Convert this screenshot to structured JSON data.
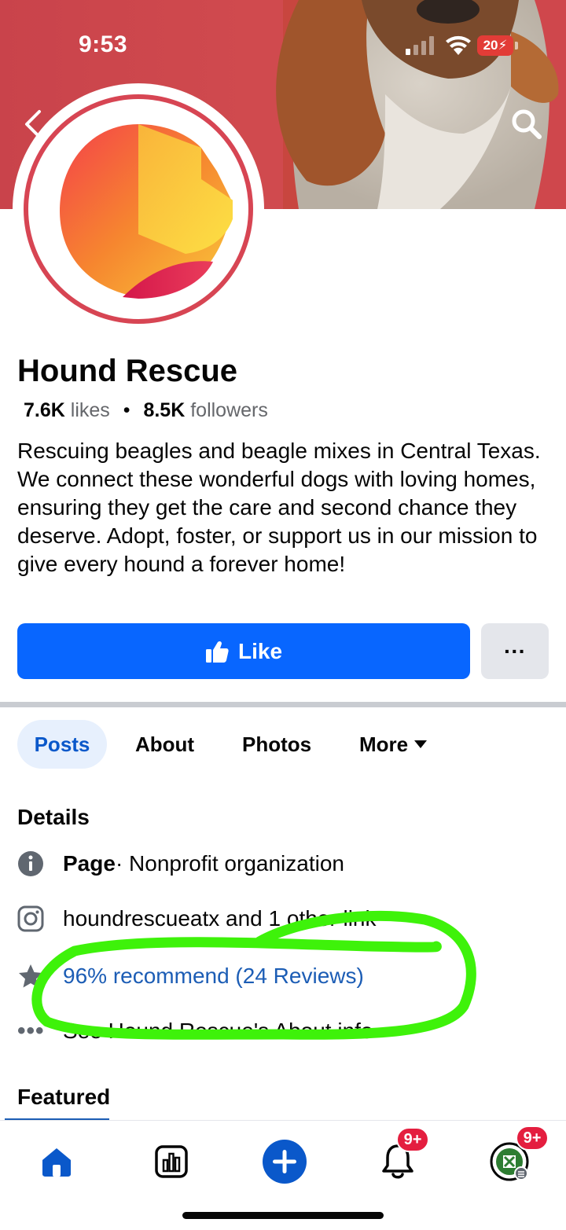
{
  "status_bar": {
    "time": "9:53",
    "battery": "20"
  },
  "page": {
    "name": "Hound Rescue",
    "likes_count": "7.6K",
    "likes_label": "likes",
    "followers_count": "8.5K",
    "followers_label": "followers",
    "bio": "Rescuing beagles and beagle mixes in Central Texas. We connect these wonderful dogs with loving homes, ensuring they get the care and second chance they deserve. Adopt, foster, or support us in our mission to give every hound a forever home!"
  },
  "actions": {
    "like_label": "Like",
    "more_label": "···"
  },
  "tabs": [
    {
      "label": "Posts",
      "active": true
    },
    {
      "label": "About",
      "active": false
    },
    {
      "label": "Photos",
      "active": false
    },
    {
      "label": "More",
      "active": false
    }
  ],
  "details": {
    "title": "Details",
    "page_label": "Page",
    "category": " · Nonprofit organization",
    "instagram": "houndrescueatx and 1 other link",
    "reviews": "96% recommend (24 Reviews)",
    "see_about": "See Hound Rescue's About info"
  },
  "featured": {
    "title": "Featured"
  },
  "bottom_nav": {
    "notifications_badge": "9+",
    "profile_badge": "9+"
  },
  "colors": {
    "brand_blue": "#0866ff",
    "link_blue": "#1c5db5",
    "cover_red": "#cf474c",
    "highlight_green": "#3ef20a",
    "badge_red": "#e41e3f"
  },
  "icons": [
    "back-icon",
    "search-icon",
    "like-thumb-icon",
    "info-icon",
    "instagram-icon",
    "star-icon",
    "more-dots-icon",
    "home-icon",
    "dashboard-icon",
    "create-icon",
    "bell-icon",
    "profile-avatar-icon"
  ]
}
